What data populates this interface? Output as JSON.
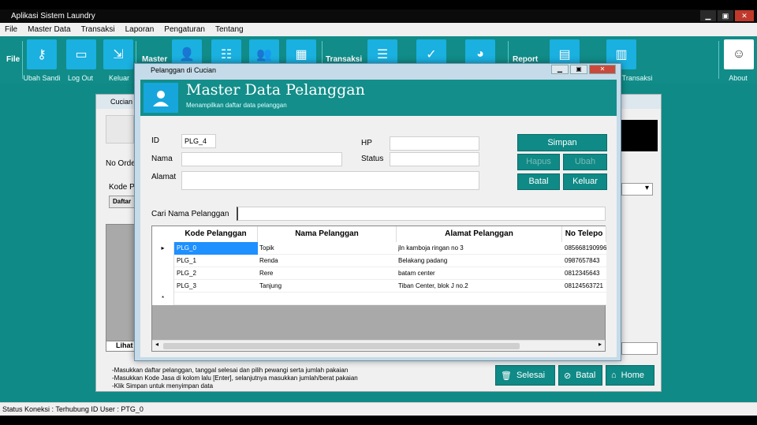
{
  "window": {
    "title": "Aplikasi Sistem Laundry",
    "min": "▁",
    "max": "▣",
    "close": "✕"
  },
  "menu": [
    "File",
    "Master Data",
    "Transaksi",
    "Laporan",
    "Pengaturan",
    "Tentang"
  ],
  "ribbon": {
    "file_label": "File",
    "groups": {
      "master": "Master",
      "transaksi": "Transaksi",
      "report": "Report"
    },
    "labels": {
      "ubah_sandi": "Ubah Sandi",
      "log_out": "Log Out",
      "keluar": "Keluar",
      "transaksi": "Transaksi",
      "about": "About"
    }
  },
  "bg_window": {
    "title": "Cucian",
    "no_order": "No Order",
    "kode_prefix": "Kode Pe",
    "daftar": "Daftar",
    "lihat": "Lihat",
    "hints": [
      "-Masukkan daftar pelanggan, tanggal selesai dan pilih pewangi serta jumlah pakaian",
      "-Masukkan Kode Jasa di kolom lalu [Enter], selanjutnya masukkan jumlah/berat pakaian",
      "-Klik Simpan untuk menyimpan data"
    ],
    "buttons": {
      "selesai": "Selesai",
      "batal": "Batal",
      "home": "Home"
    }
  },
  "dialog": {
    "title": "Pelanggan di Cucian",
    "header_title": "Master Data Pelanggan",
    "header_sub": "Menampilkan daftar data pelanggan",
    "fields": {
      "id_label": "ID",
      "id_value": "PLG_4",
      "nama_label": "Nama",
      "nama_value": "",
      "alamat_label": "Alamat",
      "alamat_value": "",
      "hp_label": "HP",
      "hp_value": "",
      "status_label": "Status",
      "status_value": ""
    },
    "buttons": {
      "simpan": "Simpan",
      "hapus": "Hapus",
      "ubah": "Ubah",
      "batal": "Batal",
      "keluar": "Keluar"
    },
    "search_label": "Cari Nama Pelanggan",
    "search_value": "",
    "columns": [
      "Kode Pelanggan",
      "Nama Pelanggan",
      "Alamat Pelanggan",
      "No Telepo"
    ],
    "rows": [
      [
        "PLG_0",
        "Topik",
        "jln kamboja ringan no 3",
        "085668190996"
      ],
      [
        "PLG_1",
        "Renda",
        "Belakang padang",
        "0987657843"
      ],
      [
        "PLG_2",
        "Rere",
        "batam center",
        "0812345643"
      ],
      [
        "PLG_3",
        "Tanjung",
        "Tiban Center, blok J no.2",
        "08124563721"
      ]
    ]
  },
  "statusbar": "Status Koneksi : Terhubung  ID User : PTG_0",
  "colors": {
    "teal": "#0f8a86",
    "ribbon_button": "#1ab0e0",
    "selected_cell": "#1e90ff"
  }
}
